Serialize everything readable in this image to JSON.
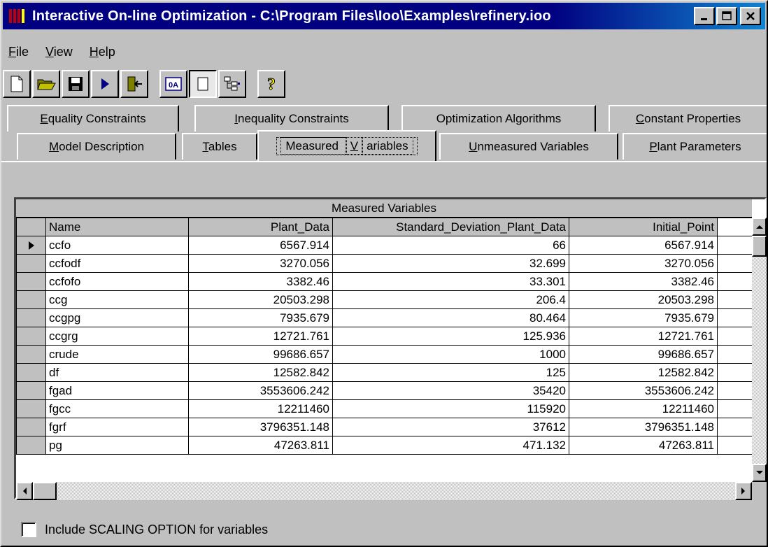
{
  "window": {
    "title": "Interactive On-line Optimization - C:\\Program Files\\Ioo\\Examples\\refinery.ioo"
  },
  "menu": {
    "items": [
      {
        "pre": "",
        "ul": "F",
        "post": "ile"
      },
      {
        "pre": "",
        "ul": "V",
        "post": "iew"
      },
      {
        "pre": "",
        "ul": "H",
        "post": "elp"
      }
    ]
  },
  "toolbar": {
    "oa_label": "0A",
    "help_label": "?"
  },
  "tabs": {
    "top": [
      {
        "pre": "",
        "ul": "E",
        "post": "quality Constraints"
      },
      {
        "pre": "",
        "ul": "I",
        "post": "nequality Constraints"
      },
      {
        "pre": "Optimization Algorithms",
        "ul": "",
        "post": ""
      },
      {
        "pre": "",
        "ul": "C",
        "post": "onstant Properties"
      }
    ],
    "bottom": [
      {
        "pre": "",
        "ul": "M",
        "post": "odel Description"
      },
      {
        "pre": "",
        "ul": "T",
        "post": "ables"
      },
      {
        "pre": "Measured ",
        "ul": "V",
        "post": "ariables"
      },
      {
        "pre": "",
        "ul": "U",
        "post": "nmeasured Variables"
      },
      {
        "pre": "",
        "ul": "P",
        "post": "lant Parameters"
      }
    ]
  },
  "grid": {
    "caption": "Measured Variables",
    "columns": [
      "Name",
      "Plant_Data",
      "Standard_Deviation_Plant_Data",
      "Initial_Point"
    ],
    "rows": [
      [
        "ccfo",
        "6567.914",
        "66",
        "6567.914"
      ],
      [
        "ccfodf",
        "3270.056",
        "32.699",
        "3270.056"
      ],
      [
        "ccfofo",
        "3382.46",
        "33.301",
        "3382.46"
      ],
      [
        "ccg",
        "20503.298",
        "206.4",
        "20503.298"
      ],
      [
        "ccgpg",
        "7935.679",
        "80.464",
        "7935.679"
      ],
      [
        "ccgrg",
        "12721.761",
        "125.936",
        "12721.761"
      ],
      [
        "crude",
        "99686.657",
        "1000",
        "99686.657"
      ],
      [
        "df",
        "12582.842",
        "125",
        "12582.842"
      ],
      [
        "fgad",
        "3553606.242",
        "35420",
        "3553606.242"
      ],
      [
        "fgcc",
        "12211460",
        "115920",
        "12211460"
      ],
      [
        "fgrf",
        "3796351.148",
        "37612",
        "3796351.148"
      ],
      [
        "pg",
        "47263.811",
        "471.132",
        "47263.811"
      ]
    ]
  },
  "scaling": {
    "label": "Include SCALING OPTION for variables",
    "checked": false
  }
}
